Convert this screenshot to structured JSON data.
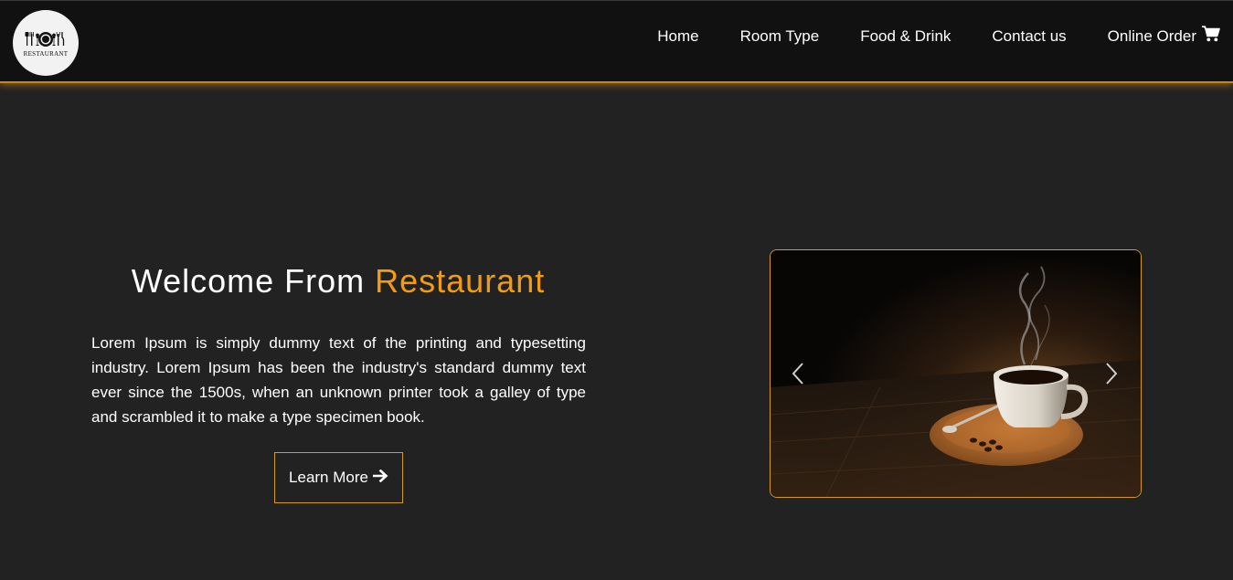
{
  "brand": {
    "logo_text": "RESTAURANT"
  },
  "nav": {
    "items": [
      {
        "label": "Home"
      },
      {
        "label": "Room Type"
      },
      {
        "label": "Food & Drink"
      },
      {
        "label": "Contact us"
      },
      {
        "label": "Online Order",
        "icon": "shopping-cart-icon"
      }
    ]
  },
  "hero": {
    "title_prefix": "Welcome From ",
    "title_highlight": "Restaurant",
    "description": "Lorem Ipsum is simply dummy text of the printing and typesetting industry. Lorem Ipsum has been the industry's standard dummy text ever since the 1500s, when an unknown printer took a galley of type and scrambled it to make a type specimen book.",
    "button_label": "Learn More",
    "button_icon": "arrow-right-icon"
  },
  "carousel": {
    "slide_image": "coffee-cup-on-wooden-table",
    "prev_icon": "chevron-left-icon",
    "next_icon": "chevron-right-icon"
  },
  "colors": {
    "background": "#222222",
    "navbar": "#111111",
    "accent": "#f39c12",
    "border_accent": "#d39a2a",
    "text": "#ffffff"
  }
}
